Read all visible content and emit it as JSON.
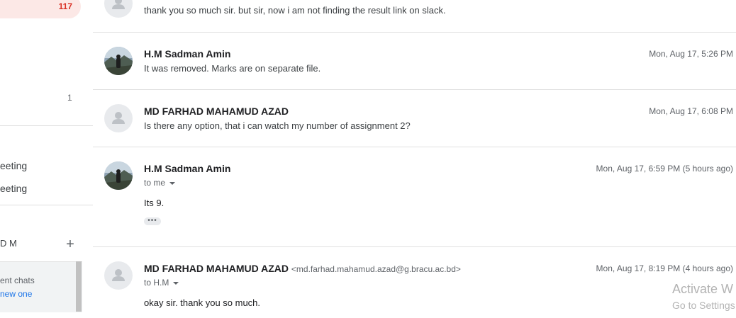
{
  "sidebar": {
    "inbox_count": "117",
    "item_count": "1",
    "meet_items": [
      "eeting",
      "eeting"
    ],
    "hangouts_user": "D M",
    "chat_text_1": "ent chats",
    "chat_text_2": "new one"
  },
  "thread": [
    {
      "sender": "",
      "snippet": "thank you so much sir. but sir, now i am not finding the result link on slack.",
      "avatar": "default-avatar"
    },
    {
      "sender": "H.M Sadman Amin",
      "snippet": "It was removed. Marks are on separate file.",
      "date": "Mon, Aug 17, 5:26 PM",
      "avatar": "photo-avatar"
    },
    {
      "sender": "MD FARHAD MAHAMUD AZAD",
      "snippet": "Is there any option, that i can watch my number of assignment 2?",
      "date": "Mon, Aug 17, 6:08 PM",
      "avatar": "default-avatar"
    },
    {
      "sender": "H.M Sadman Amin",
      "to": "to me",
      "body": "Its 9.",
      "date": "Mon, Aug 17, 6:59 PM (5 hours ago)",
      "avatar": "photo-avatar"
    },
    {
      "sender": "MD FARHAD MAHAMUD AZAD",
      "email": "<md.farhad.mahamud.azad@g.bracu.ac.bd>",
      "to": "to H.M",
      "body": "okay sir. thank you so much.",
      "date": "Mon, Aug 17, 8:19 PM (4 hours ago)",
      "avatar": "default-avatar"
    }
  ],
  "watermark": {
    "line1": "Activate W",
    "line2": "Go to Settings"
  },
  "colors": {
    "inbox_highlight": "#fce8e6",
    "inbox_count": "#d93025",
    "link": "#1a73e8"
  }
}
